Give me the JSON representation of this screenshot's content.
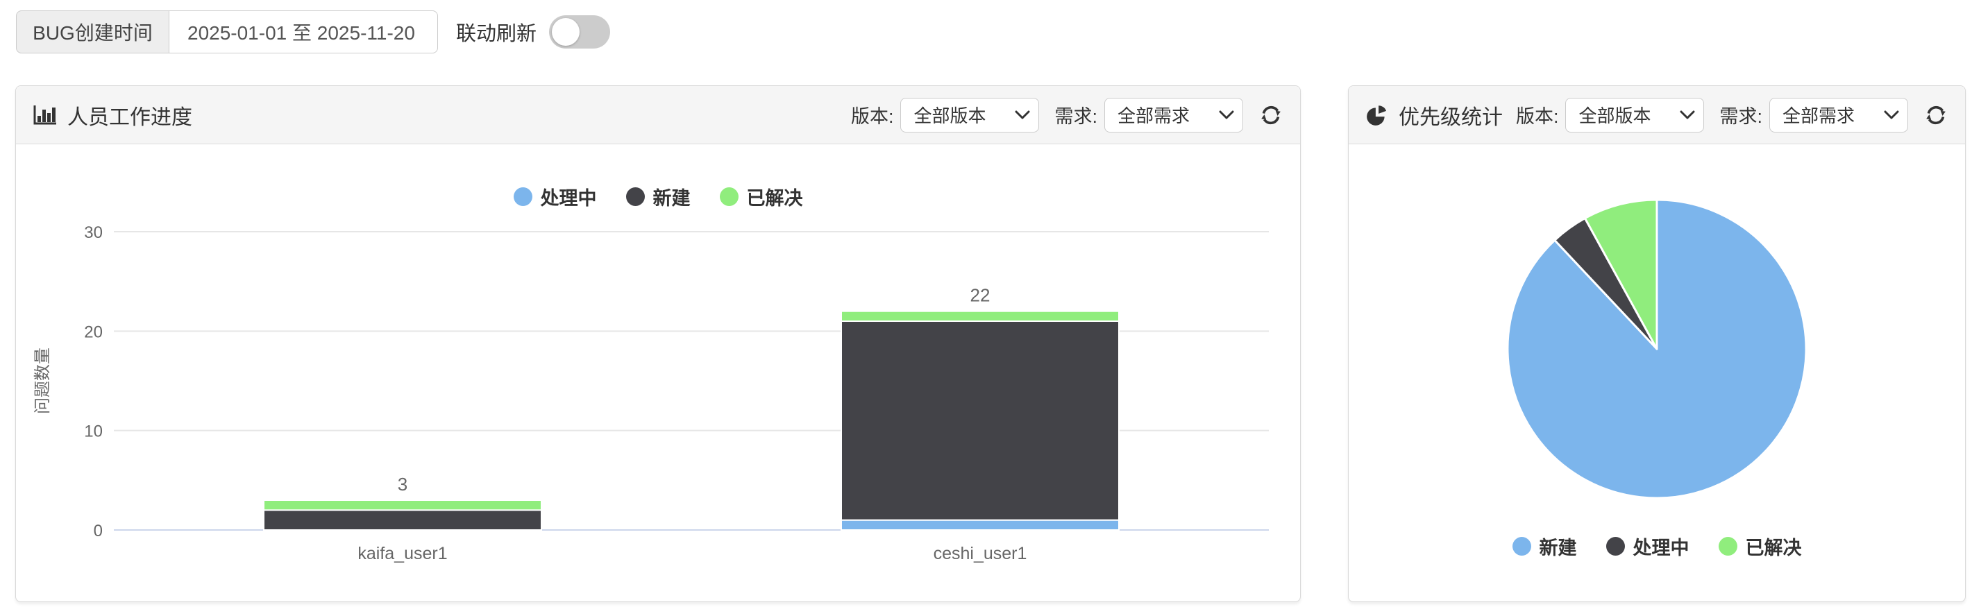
{
  "filter_bar": {
    "date_label": "BUG创建时间",
    "date_range": "2025-01-01 至 2025-11-20",
    "linked_refresh_label": "联动刷新",
    "toggle_state": "off"
  },
  "panels": {
    "progress": {
      "title": "人员工作进度",
      "icon": "bar-chart-icon",
      "version_label": "版本:",
      "version_value": "全部版本",
      "requirement_label": "需求:",
      "requirement_value": "全部需求"
    },
    "priority": {
      "title": "优先级统计",
      "icon": "pie-chart-icon",
      "version_label": "版本:",
      "version_value": "全部版本",
      "requirement_label": "需求:",
      "requirement_value": "全部需求"
    }
  },
  "colors": {
    "blue": "#7cb5ec",
    "dark": "#434348",
    "green": "#90ed7d",
    "grid": "#e6e6e6",
    "axis_line": "#ccd6eb",
    "tick_text": "#666666"
  },
  "chart_data": [
    {
      "type": "bar",
      "stacked": true,
      "title": "人员工作进度",
      "categories": [
        "kaifa_user1",
        "ceshi_user1"
      ],
      "series": [
        {
          "name": "处理中",
          "color": "#7cb5ec",
          "values": [
            0,
            1
          ]
        },
        {
          "name": "新建",
          "color": "#434348",
          "values": [
            2,
            20
          ]
        },
        {
          "name": "已解决",
          "color": "#90ed7d",
          "values": [
            1,
            1
          ]
        }
      ],
      "stack_totals": [
        3,
        22
      ],
      "xlabel": "",
      "ylabel": "问题数量",
      "ylim": [
        0,
        30
      ],
      "yticks": [
        0,
        10,
        20,
        30
      ],
      "grid": true,
      "legend_position": "top"
    },
    {
      "type": "pie",
      "title": "优先级统计",
      "labels": [
        "新建",
        "处理中",
        "已解决"
      ],
      "values": [
        22,
        1,
        2
      ],
      "colors": [
        "#7cb5ec",
        "#434348",
        "#90ed7d"
      ],
      "start_angle_deg": -90,
      "direction": "clockwise",
      "legend_position": "bottom"
    }
  ]
}
